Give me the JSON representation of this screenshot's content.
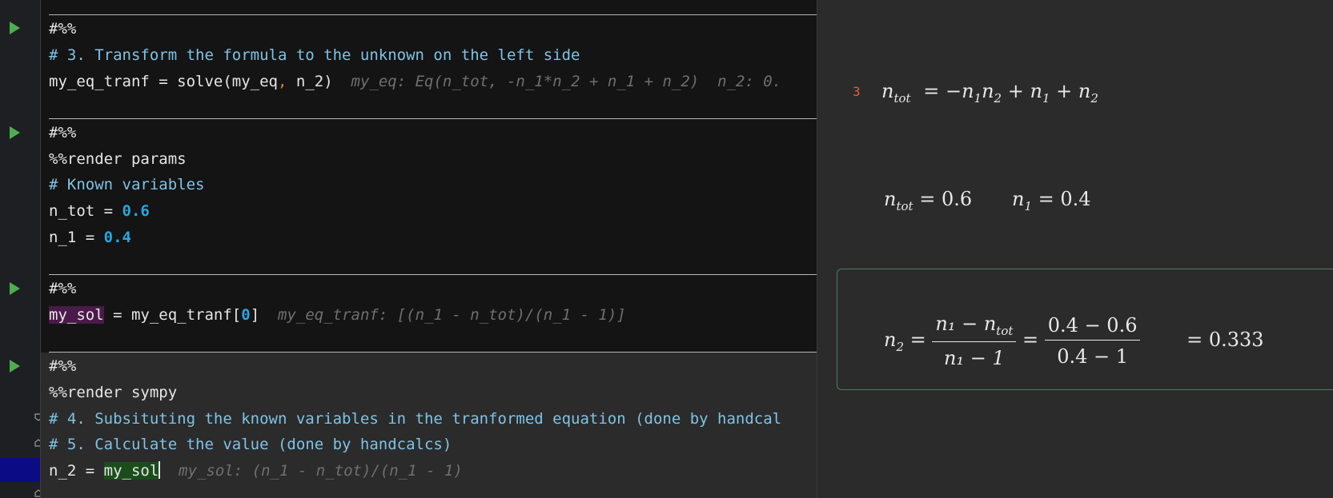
{
  "editor": {
    "cells": [
      {
        "lines": [
          {
            "marker": "#%%"
          },
          {
            "comment": "# 3. Transform the formula to the unknown on the left side"
          },
          {
            "code_a": "my_eq_tranf = solve(my_eq",
            "punct": ",",
            "code_b": " n_2)",
            "hint": "my_eq: Eq(n_tot, -n_1*n_2 + n_1 + n_2)  n_2: 0."
          }
        ]
      },
      {
        "lines": [
          {
            "marker": "#%%"
          },
          {
            "code": "%%render params"
          },
          {
            "comment": "# Known variables"
          },
          {
            "name": "n_tot = ",
            "value": "0.6"
          },
          {
            "name": "n_1 = ",
            "value": "0.4"
          }
        ]
      },
      {
        "lines": [
          {
            "marker": "#%%"
          },
          {
            "highlight": "my_sol",
            "code_a": " = my_eq_tranf[",
            "index": "0",
            "code_b": "]",
            "hint": "my_eq_tranf: [(n_1 - n_tot)/(n_1 - 1)]"
          }
        ]
      },
      {
        "lines": [
          {
            "marker": "#%%"
          },
          {
            "code": "%%render sympy"
          },
          {
            "comment": "# 4. Subsituting the known variables in the tranformed equation (done by handcal"
          },
          {
            "comment": "# 5. Calculate the value (done by handcalcs)"
          },
          {
            "code_a": "n_2 = ",
            "highlight": "my_sol",
            "hint": "my_sol: (n_1 - n_tot)/(n_1 - 1)"
          }
        ]
      }
    ]
  },
  "preview": {
    "eq_number": "3",
    "equation1": {
      "lhs": "n",
      "lhs_sub": "tot",
      "rhs_parts": [
        "= −",
        "n",
        "1",
        "n",
        "2",
        " + ",
        "n",
        "1",
        " + ",
        "n",
        "2"
      ]
    },
    "params": {
      "n_tot_sub": "tot",
      "n_tot_value": "= 0.6",
      "n_1_sub": "1",
      "n_1_value": "= 0.4"
    },
    "result": {
      "lhs_sub": "2",
      "frac1_num": "n₁ − n",
      "frac1_num_sub": "tot",
      "frac1_den": "n₁ − 1",
      "frac2_num": "0.4 − 0.6",
      "frac2_den": "0.4 − 1",
      "value": "= 0.333"
    }
  }
}
